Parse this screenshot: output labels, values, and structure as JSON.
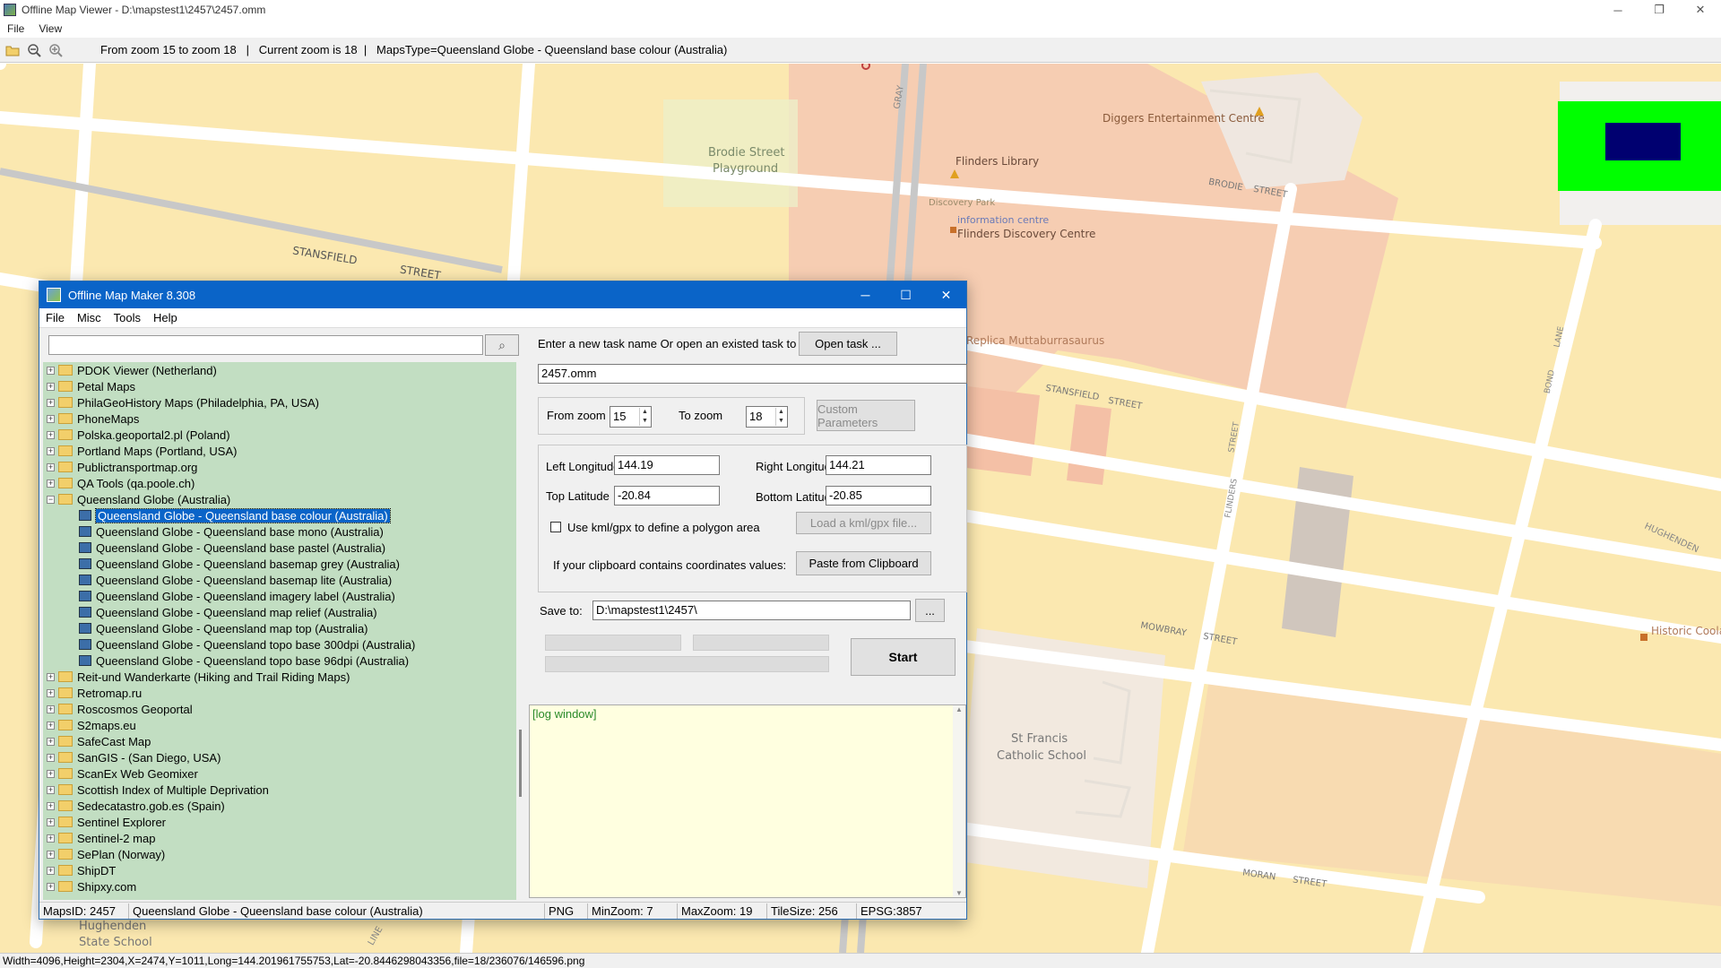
{
  "window": {
    "title": "Offline Map Viewer - D:\\mapstest1\\2457\\2457.omm",
    "controls": {
      "minimize": "─",
      "restore": "❐",
      "close": "✕"
    }
  },
  "menu": [
    "File",
    "View"
  ],
  "toolbar": {
    "info": "From zoom 15 to zoom 18   |   Current zoom is 18  |   MapsType=Queensland Globe - Queensland base colour (Australia)"
  },
  "map_labels": {
    "diggers": "Diggers Entertainment Centre",
    "brodie_playground_1": "Brodie Street",
    "brodie_playground_2": "Playground",
    "flinders_library": "Flinders Library",
    "discovery_park": "Discovery Park",
    "info_centre": "information centre",
    "flinders_discovery": "Flinders Discovery Centre",
    "stansfield_1": "STANSFIELD",
    "stansfield_2": "STREET",
    "stansfield_3": "STANSFIELD",
    "stansfield_4": "STREET",
    "gray": "GRAY",
    "brodie_1": "BRODIE",
    "brodie_2": "STREET",
    "replica": "Replica Muttaburrasaurus",
    "lane": "LANE",
    "bond": "BOND",
    "flinders_1": "FLINDERS",
    "flinders_2": "STREET",
    "hughenden_road": "HUGHENDEN",
    "mowbray_1": "MOWBRAY",
    "mowbray_2": "STREET",
    "historic": "Historic Coola",
    "stfrancis_1": "St Francis",
    "stfrancis_2": "Catholic School",
    "moran_1": "MORAN",
    "moran_2": "STREET",
    "hughenden_school_1": "Hughenden",
    "hughenden_school_2": "State School",
    "line": "LINE"
  },
  "statusbar": "Width=4096,Height=2304,X=2474,Y=1011,Long=144.201961755753,Lat=-20.8446298043356,file=18/236076/146596.png",
  "dialog": {
    "title": "Offline Map Maker 8.308",
    "menu": [
      "File",
      "Misc",
      "Tools",
      "Help"
    ],
    "search_value": "",
    "tree": [
      {
        "label": "PDOK Viewer (Netherland)",
        "type": "folder"
      },
      {
        "label": "Petal Maps",
        "type": "folder"
      },
      {
        "label": "PhilaGeoHistory Maps (Philadelphia, PA, USA)",
        "type": "folder"
      },
      {
        "label": "PhoneMaps",
        "type": "folder"
      },
      {
        "label": "Polska.geoportal2.pl (Poland)",
        "type": "folder"
      },
      {
        "label": "Portland Maps (Portland, USA)",
        "type": "folder"
      },
      {
        "label": "Publictransportmap.org",
        "type": "folder"
      },
      {
        "label": "QA Tools (qa.poole.ch)",
        "type": "folder"
      },
      {
        "label": "Queensland Globe (Australia)",
        "type": "open"
      },
      {
        "label": "Queensland Globe - Queensland base colour (Australia)",
        "type": "leaf",
        "selected": true
      },
      {
        "label": "Queensland Globe - Queensland base mono (Australia)",
        "type": "leaf"
      },
      {
        "label": "Queensland Globe - Queensland base pastel (Australia)",
        "type": "leaf"
      },
      {
        "label": "Queensland Globe - Queensland basemap grey (Australia)",
        "type": "leaf"
      },
      {
        "label": "Queensland Globe - Queensland basemap lite (Australia)",
        "type": "leaf"
      },
      {
        "label": "Queensland Globe - Queensland imagery label (Australia)",
        "type": "leaf"
      },
      {
        "label": "Queensland Globe - Queensland map relief (Australia)",
        "type": "leaf"
      },
      {
        "label": "Queensland Globe - Queensland map top (Australia)",
        "type": "leaf"
      },
      {
        "label": "Queensland Globe - Queensland topo base 300dpi (Australia)",
        "type": "leaf"
      },
      {
        "label": "Queensland Globe - Queensland topo base 96dpi (Australia)",
        "type": "leaf"
      },
      {
        "label": "Reit-und Wanderkarte (Hiking and Trail Riding Maps)",
        "type": "folder"
      },
      {
        "label": "Retromap.ru",
        "type": "folder"
      },
      {
        "label": "Roscosmos Geoportal",
        "type": "folder"
      },
      {
        "label": "S2maps.eu",
        "type": "folder"
      },
      {
        "label": "SafeCast Map",
        "type": "folder"
      },
      {
        "label": "SanGIS - (San Diego, USA)",
        "type": "folder"
      },
      {
        "label": "ScanEx Web Geomixer",
        "type": "folder"
      },
      {
        "label": "Scottish Index of Multiple Deprivation",
        "type": "folder"
      },
      {
        "label": "Sedecatastro.gob.es (Spain)",
        "type": "folder"
      },
      {
        "label": "Sentinel Explorer",
        "type": "folder"
      },
      {
        "label": "Sentinel-2 map",
        "type": "folder"
      },
      {
        "label": "SePlan (Norway)",
        "type": "folder"
      },
      {
        "label": "ShipDT",
        "type": "folder"
      },
      {
        "label": "Shipxy.com",
        "type": "folder"
      }
    ],
    "task_prompt": "Enter a new task name Or open an existed task to continue:",
    "open_task": "Open task ...",
    "task_name": "2457.omm",
    "from_zoom_label": "From zoom",
    "from_zoom": "15",
    "to_zoom_label": "To zoom",
    "to_zoom": "18",
    "custom_params": "Custom Parameters",
    "left_lon_label": "Left Longitude",
    "left_lon": "144.19",
    "right_lon_label": "Right Longitude",
    "right_lon": "144.21",
    "top_lat_label": "Top Latitude",
    "top_lat": "-20.84",
    "bottom_lat_label": "Bottom Latitude",
    "bottom_lat": "-20.85",
    "kml_label": "Use kml/gpx to define a polygon area",
    "kml_btn": "Load a kml/gpx file...",
    "clipboard_label": "If your clipboard contains coordinates values:",
    "clipboard_btn": "Paste from Clipboard",
    "save_label": "Save to:",
    "save_path": "D:\\mapstest1\\2457\\",
    "browse": "...",
    "start": "Start",
    "log": "[log window]",
    "status": {
      "maps_id": "MapsID: 2457",
      "maps_name": "Queensland Globe - Queensland base colour (Australia)",
      "format": "PNG",
      "min_zoom": "MinZoom: 7",
      "max_zoom": "MaxZoom: 19",
      "tile_size": "TileSize: 256",
      "epsg": "EPSG:3857"
    }
  },
  "colors": {
    "accent": "#0a64c8",
    "tree_bg": "#c2dec2",
    "map_bg": "#fbe8b0",
    "log_bg": "#ffffe0"
  }
}
